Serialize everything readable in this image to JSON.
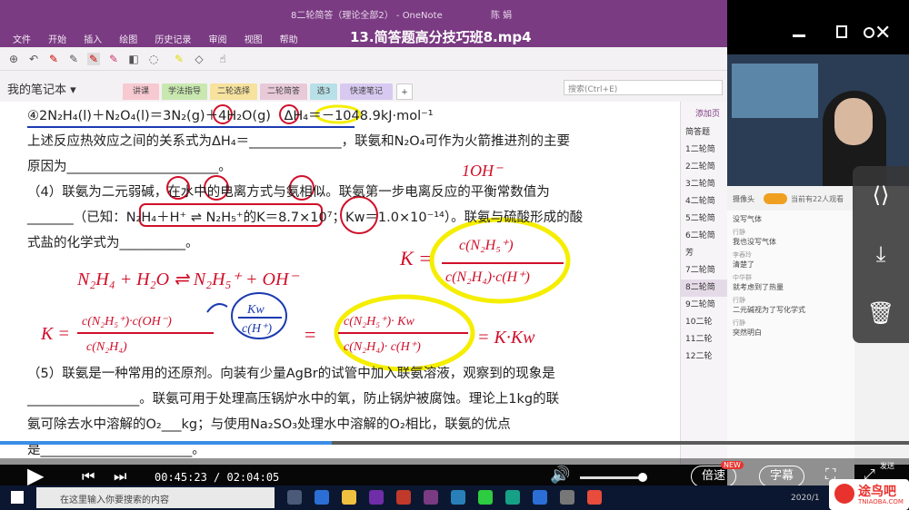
{
  "window": {
    "onenote_title": "8二轮简答（理论全部2） - OneNote",
    "user": "陈 娟",
    "video_title": "13.简答题高分技巧班8.mp4"
  },
  "menu": [
    "文件",
    "开始",
    "插入",
    "绘图",
    "历史记录",
    "审阅",
    "视图",
    "帮助"
  ],
  "notebook": {
    "name": "我的笔记本"
  },
  "tabs": [
    "讲课",
    "学法指导",
    "二轮选择",
    "二轮简答",
    "选3",
    "快速笔记",
    "+"
  ],
  "search": {
    "placeholder": "搜索(Ctrl+E)"
  },
  "page_text": {
    "l1a": "④2N₂H₄(l)＋N₂O₄(l)＝3N₂(g)＋4H₂O(g)　ΔH₄＝－1048.9kJ·mol⁻¹",
    "l2": "上述反应热效应之间的关系式为ΔH₄＝______________，联氨和N₂O₄可作为火箭推进剂的主要",
    "l3": "原因为_______________________。",
    "l4": "（4）联氨为二元弱碱，在水中的电离方式与氨相似。联氨第一步电离反应的平衡常数值为",
    "l5": "_______（已知：N₂H₄＋H⁺ ⇌ N₂H₅⁺的K＝8.7×10⁷；Kw＝1.0×10⁻¹⁴）。联氨与硫酸形成的酸",
    "l6": "式盐的化学式为__________。",
    "l7": "（5）联氨是一种常用的还原剂。向装有少量AgBr的试管中加入联氨溶液，观察到的现象是",
    "l8": "_________________。联氨可用于处理高压锅炉水中的氧，防止锅炉被腐蚀。理论上1kg的联",
    "l9": "氨可除去水中溶解的O₂___kg；与使用Na₂SO₃处理水中溶解的O₂相比，联氨的优点",
    "l10": "是_______________________。"
  },
  "ink": {
    "ion": "1OH⁻",
    "eq": "N₂H₄ + H₂O ⇌ N₂H₅⁺ + OH⁻",
    "k_frac_top": "c(N₂H₅⁺)",
    "k_frac_bot": "c(N₂H₄)·c(H⁺)",
    "k_left": "K =",
    "k2_top": "c(N₂H₅⁺)·c(OH⁻)",
    "k2_bot": "c(N₂H₄)",
    "kw_top": "Kw",
    "kw_bot": "c(H⁺)",
    "k3_top": "c(N₂H₅⁺)· Kw",
    "k3_bot": "c(N₂H₄)· c(H⁺)",
    "result": "= K·Kw",
    "eq_sign": "="
  },
  "sidebar_pages": {
    "add": "添加页",
    "items": [
      "简答题",
      "1二轮简",
      "2二轮简",
      "3二轮简",
      "4二轮简",
      "5二轮简",
      "6二轮简",
      "芳",
      "7二轮简",
      "8二轮简",
      "9二轮简",
      "10二轮",
      "11二轮",
      "12二轮"
    ]
  },
  "live": {
    "cam_label": "摄像头",
    "viewers": "当前有22人观看",
    "messages": [
      {
        "name": "",
        "text": "没写气体"
      },
      {
        "name": "行静",
        "text": "我也没写气体"
      },
      {
        "name": "李舂玲",
        "text": "清楚了"
      },
      {
        "name": "中华群",
        "text": "就考虑到了热量"
      },
      {
        "name": "行静",
        "text": "二元碱视为了写化学式"
      },
      {
        "name": "行静",
        "text": "突然明白"
      }
    ]
  },
  "player": {
    "current": "00:45:23",
    "total": "02:04:05",
    "speed": "倍速",
    "new_badge": "NEW",
    "subtitle": "字幕",
    "send": "发送",
    "progress": 0.365,
    "volume": 1.0
  },
  "taskbar": {
    "search_placeholder": "在这里输入你要搜索的内容",
    "clock": "2020/1"
  },
  "watermark": {
    "text": "途鸟吧",
    "url": "TNIAOBA.COM"
  },
  "colors": {
    "onenote": "#7a3b82",
    "ink_red": "#d0102a",
    "ink_yellow": "#f5ee00",
    "ink_blue": "#1a3ab0",
    "progress": "#3a8ee6"
  }
}
